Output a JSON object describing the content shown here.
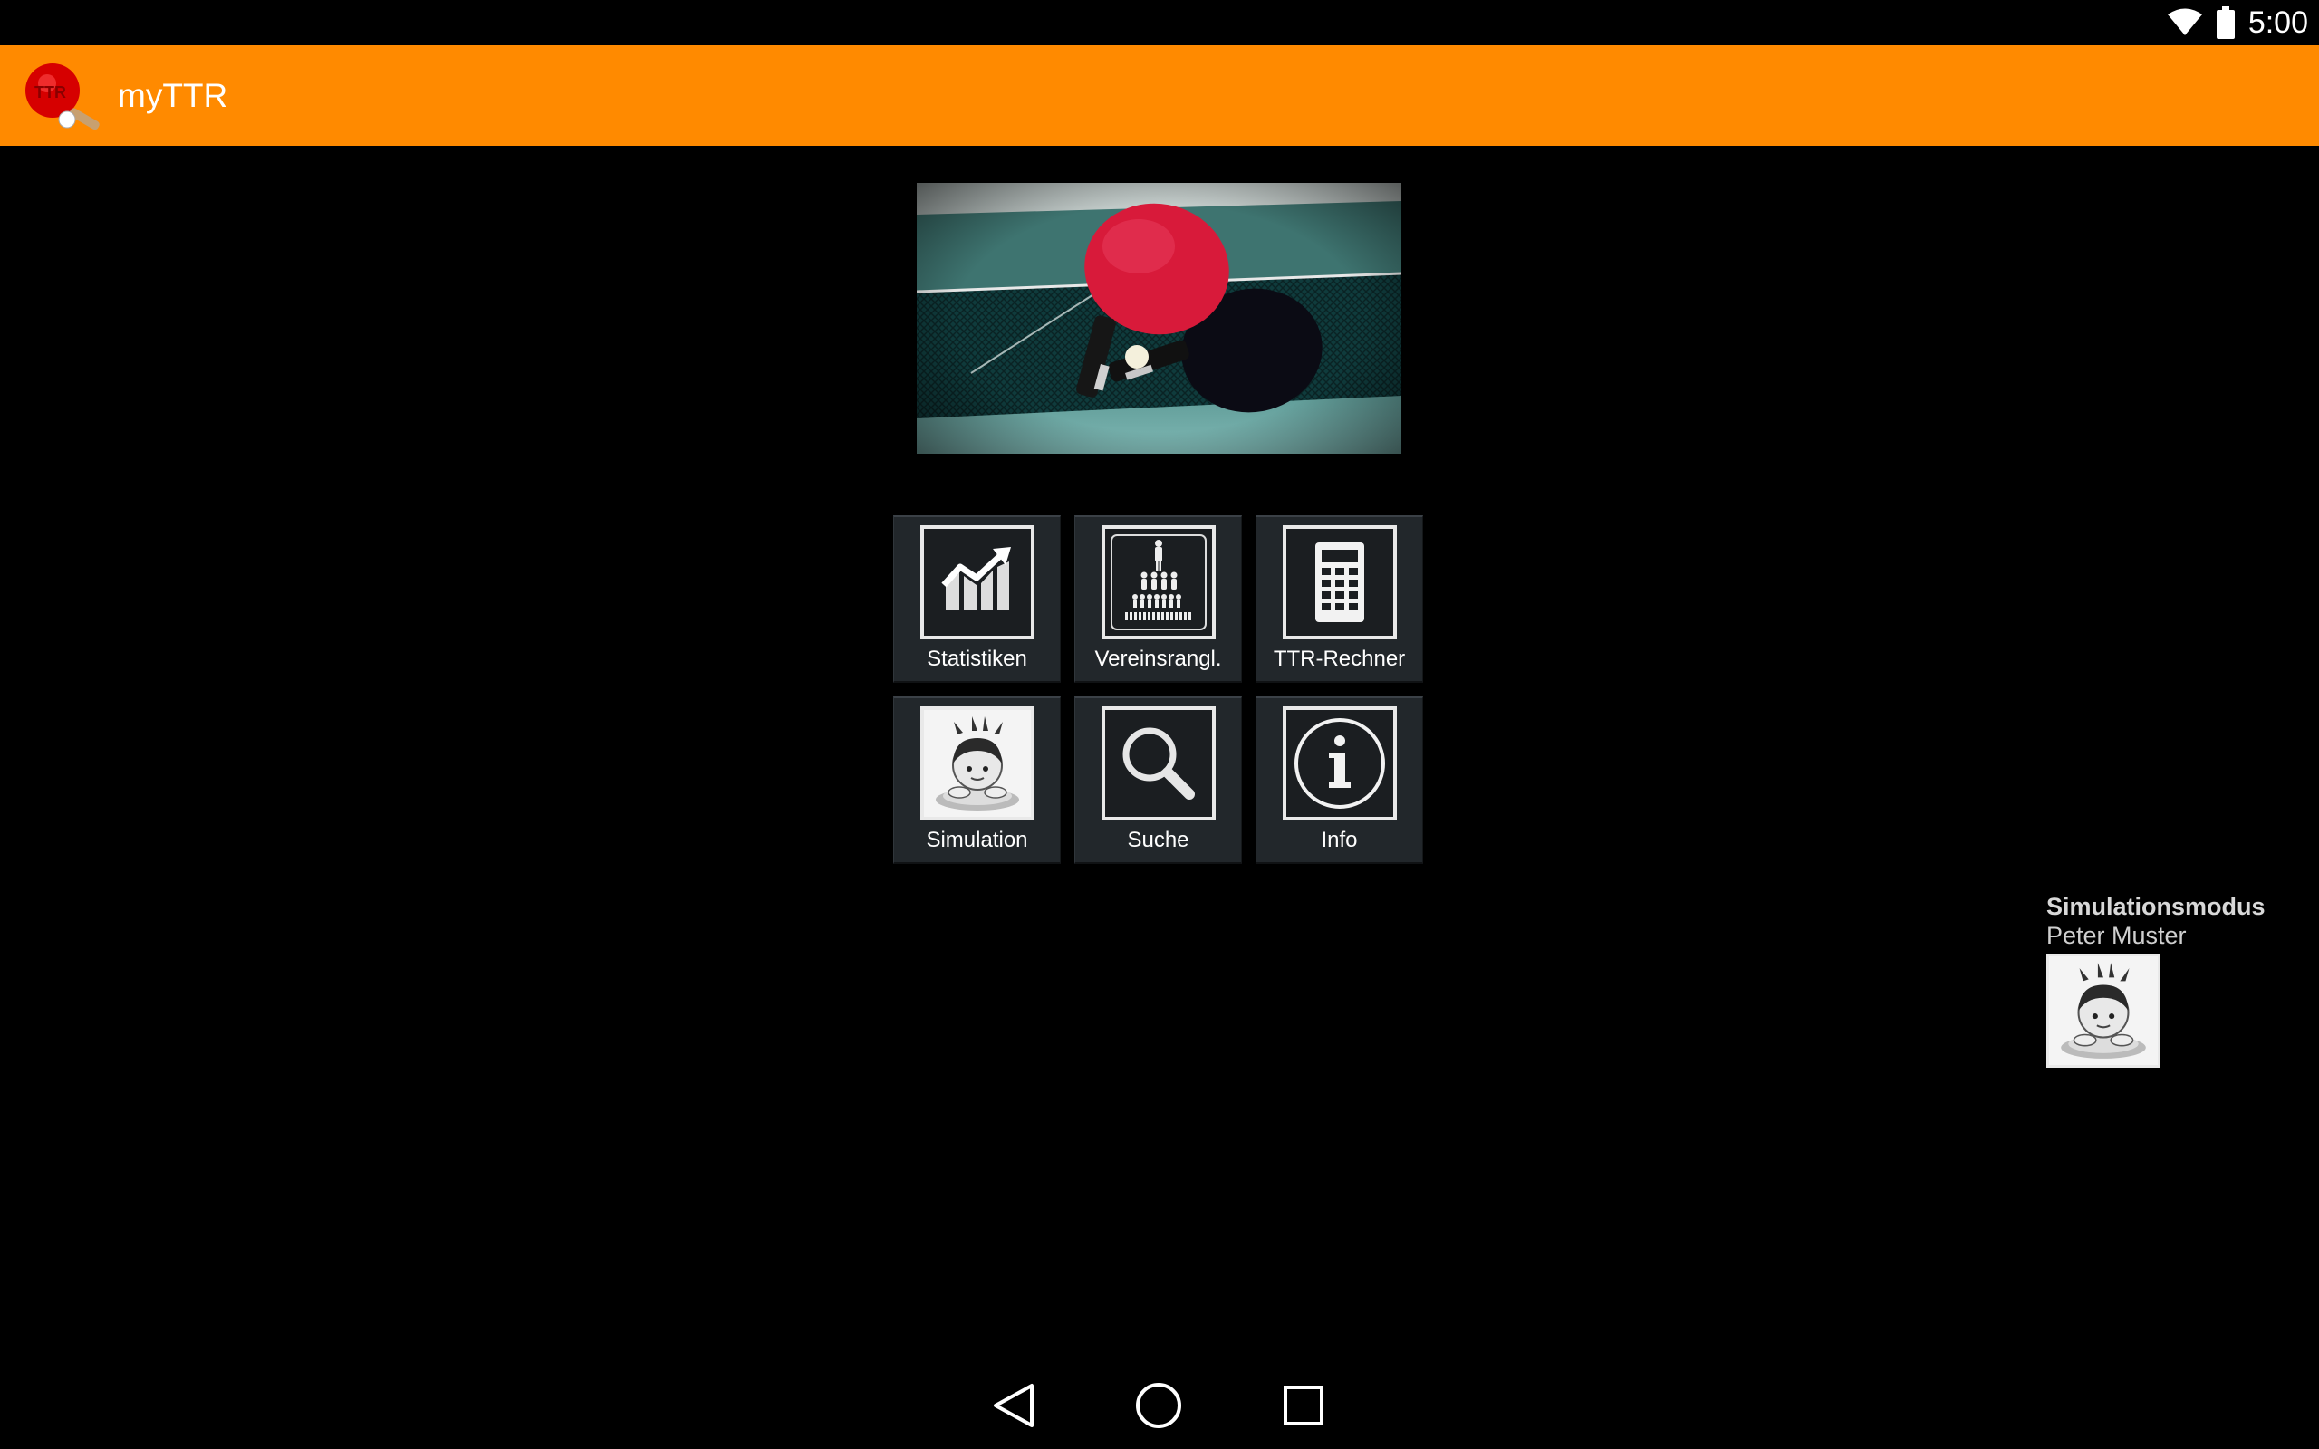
{
  "status_bar": {
    "time": "5:00",
    "icons": [
      "wifi-icon",
      "battery-icon"
    ]
  },
  "action_bar": {
    "title": "myTTR",
    "background_color": "#ff8a00",
    "logo_icon": "table-tennis-paddle-logo"
  },
  "hero": {
    "description_icon": "table-tennis-paddles-photo"
  },
  "tiles": [
    {
      "label": "Statistiken",
      "icon": "chart-icon"
    },
    {
      "label": "Vereinsrangl.",
      "icon": "ranking-pyramid-icon"
    },
    {
      "label": "TTR-Rechner",
      "icon": "calculator-icon"
    },
    {
      "label": "Simulation",
      "icon": "avatar-icon"
    },
    {
      "label": "Suche",
      "icon": "search-icon"
    },
    {
      "label": "Info",
      "icon": "info-icon"
    }
  ],
  "simulation": {
    "title": "Simulationsmodus",
    "name": "Peter Muster",
    "avatar_icon": "avatar-icon"
  },
  "nav_bar": {
    "buttons": [
      "back-icon",
      "home-icon",
      "recents-icon"
    ]
  }
}
